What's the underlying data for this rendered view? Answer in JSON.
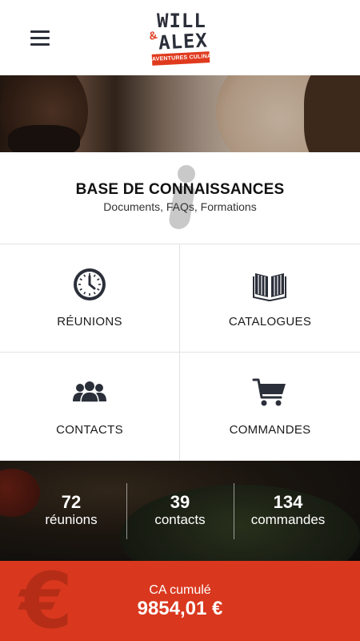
{
  "header": {
    "menu_icon": "hamburger-icon",
    "logo": {
      "line1": "WILL",
      "amp": "&",
      "line2": "ALEX",
      "tagline": "AVENTURES CULINAIRES"
    }
  },
  "knowledge_base": {
    "icon": "info-icon",
    "title": "BASE DE CONNAISSANCES",
    "subtitle": "Documents, FAQs, Formations"
  },
  "tiles": [
    {
      "label": "RÉUNIONS",
      "icon": "clock-icon"
    },
    {
      "label": "CATALOGUES",
      "icon": "book-icon"
    },
    {
      "label": "CONTACTS",
      "icon": "users-icon"
    },
    {
      "label": "COMMANDES",
      "icon": "cart-icon"
    }
  ],
  "stats": [
    {
      "value": "72",
      "label": "réunions"
    },
    {
      "value": "39",
      "label": "contacts"
    },
    {
      "value": "134",
      "label": "commandes"
    }
  ],
  "revenue": {
    "icon": "euro-icon",
    "label": "CA cumulé",
    "value": "9854,01 €"
  },
  "colors": {
    "brand_red": "#d9381e",
    "icon_dark": "#2b2f3a"
  }
}
